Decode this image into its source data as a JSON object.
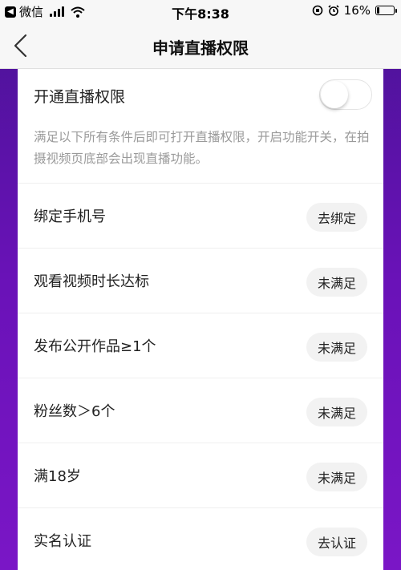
{
  "status_bar": {
    "carrier": "微信",
    "time": "下午8:38",
    "battery_percent_label": "16%",
    "battery_level": 0.16
  },
  "nav": {
    "title": "申请直播权限"
  },
  "live_toggle": {
    "label": "开通直播权限",
    "enabled": false
  },
  "description": "满足以下所有条件后即可打开直播权限，开启功能开关，在拍摄视频页底部会出现直播功能。",
  "requirements": [
    {
      "label": "绑定手机号",
      "action": "去绑定"
    },
    {
      "label": "观看视频时长达标",
      "action": "未满足"
    },
    {
      "label": "发布公开作品≥1个",
      "action": "未满足"
    },
    {
      "label": "粉丝数＞6个",
      "action": "未满足"
    },
    {
      "label": "满18岁",
      "action": "未满足"
    },
    {
      "label": "实名认证",
      "action": "去认证"
    }
  ],
  "colors": {
    "background_purple": "#6a12b8",
    "card": "#ffffff",
    "button_bg": "#f2f2f2",
    "desc_text": "#9a9a9a"
  }
}
